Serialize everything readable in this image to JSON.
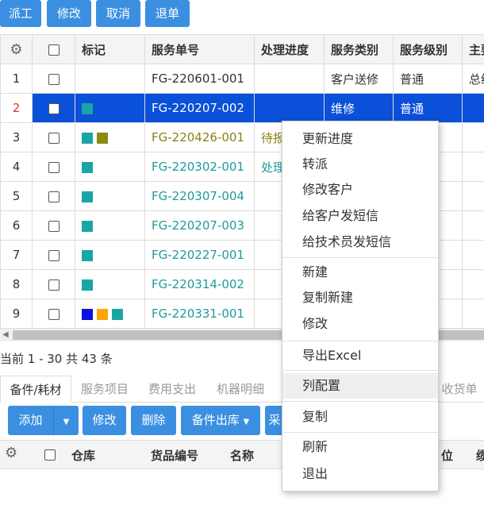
{
  "toolbar": {
    "dispatch": "派工",
    "edit": "修改",
    "cancel": "取消",
    "reject": "退单"
  },
  "grid": {
    "headers": [
      "",
      "",
      "标记",
      "服务单号",
      "处理进度",
      "服务类别",
      "服务级别",
      "主要"
    ],
    "rows": [
      {
        "num": "1",
        "order": "FG-220601-001",
        "progress": "",
        "category": "客户送修",
        "level": "普通",
        "main": "总经"
      },
      {
        "num": "2",
        "order": "FG-220207-002",
        "progress": "",
        "category": "维修",
        "level": "普通",
        "main": ""
      },
      {
        "num": "3",
        "order": "FG-220426-001",
        "progress": "待报",
        "category": "",
        "level": "",
        "main": ""
      },
      {
        "num": "4",
        "order": "FG-220302-001",
        "progress": "处理",
        "category": "",
        "level": "",
        "main": ""
      },
      {
        "num": "5",
        "order": "FG-220307-004",
        "progress": "",
        "category": "",
        "level": "",
        "main": ""
      },
      {
        "num": "6",
        "order": "FG-220207-003",
        "progress": "",
        "category": "",
        "level": "",
        "main": ""
      },
      {
        "num": "7",
        "order": "FG-220227-001",
        "progress": "",
        "category": "",
        "level": "",
        "main": ""
      },
      {
        "num": "8",
        "order": "FG-220314-002",
        "progress": "",
        "category": "",
        "level": "",
        "main": ""
      },
      {
        "num": "9",
        "order": "FG-220331-001",
        "progress": "",
        "category": "",
        "level": "",
        "main": ""
      }
    ]
  },
  "colors": {
    "teal": "#1aa5a5",
    "olive": "#8a8a10",
    "blue": "#1010e0",
    "orange": "#ffa500",
    "selected": "#0a50d8",
    "button": "#3b8fe0"
  },
  "pager": "当前 1 - 30 共 43 条",
  "tabs": [
    "备件/耗材",
    "服务项目",
    "费用支出",
    "机器明细",
    "收货单"
  ],
  "subtoolbar": {
    "add": "添加",
    "edit": "修改",
    "delete": "删除",
    "outbound": "备件出库",
    "partial": "采"
  },
  "subgrid": {
    "headers": [
      "",
      "",
      "仓库",
      "货品编号",
      "名称",
      "位",
      "缆"
    ]
  },
  "context_menu": [
    "更新进度",
    "转派",
    "修改客户",
    "给客户发短信",
    "给技术员发短信",
    "新建",
    "复制新建",
    "修改",
    "导出Excel",
    "列配置",
    "复制",
    "刷新",
    "退出"
  ]
}
